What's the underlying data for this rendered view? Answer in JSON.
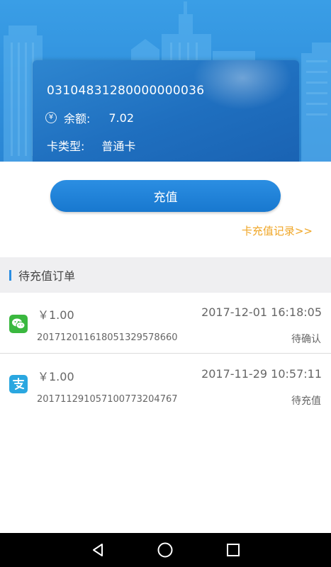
{
  "card": {
    "number": "03104831280000000036",
    "balance_label": "余额:",
    "balance_value": "7.02",
    "currency_icon": "yen-circle-icon",
    "type_label": "卡类型:",
    "type_value": "普通卡"
  },
  "actions": {
    "recharge_label": "充值",
    "history_link": "卡充值记录>>"
  },
  "pending": {
    "title": "待充值订单",
    "orders": [
      {
        "pay_method_icon": "wechat-pay-icon",
        "amount": "￥1.00",
        "time": "2017-12-01 16:18:05",
        "order_no": "20171201161805132957866​0",
        "status": "待确认"
      },
      {
        "pay_method_icon": "alipay-icon",
        "amount": "￥1.00",
        "time": "2017-11-29 10:57:11",
        "order_no": "20171129105710077320476​7",
        "status": "待充值"
      }
    ]
  },
  "colors": {
    "primary": "#2b8ee2",
    "link": "#f0a626",
    "wechat": "#3ab83f",
    "alipay": "#2aa7e0"
  },
  "navbar": {
    "icons": [
      "back-icon",
      "home-icon",
      "recents-icon"
    ]
  }
}
